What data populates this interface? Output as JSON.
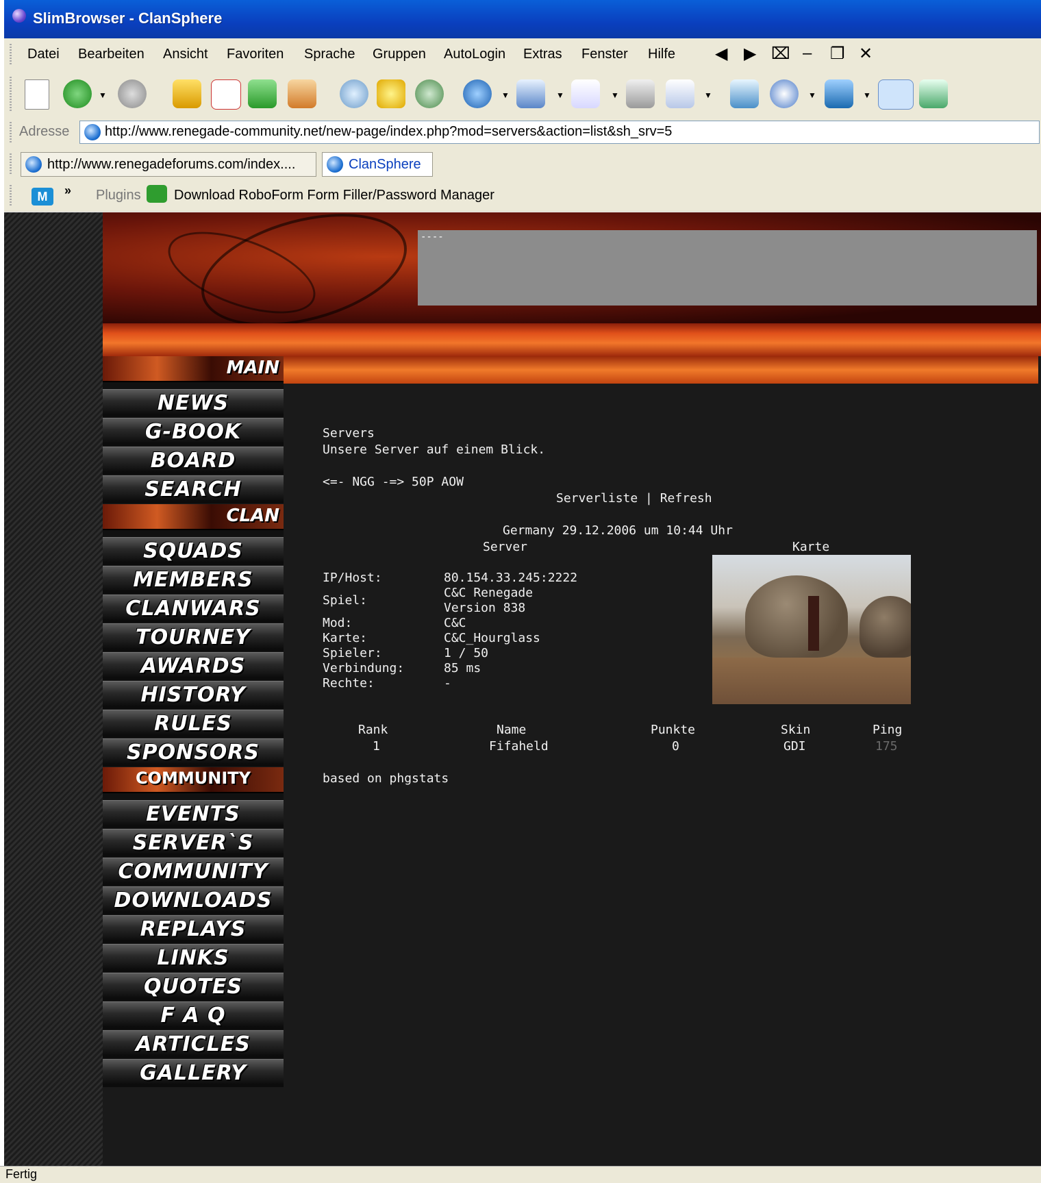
{
  "window": {
    "title": "SlimBrowser - ClanSphere"
  },
  "menu": {
    "items": [
      "Datei",
      "Bearbeiten",
      "Ansicht",
      "Favoriten",
      "Sprache",
      "Gruppen",
      "AutoLogin",
      "Extras",
      "Fenster",
      "Hilfe"
    ]
  },
  "toolbar": {
    "icons": [
      "new-page-icon",
      "back-icon",
      "forward-icon",
      "up-folder-icon",
      "stop-icon",
      "refresh-icon",
      "home-icon",
      "search-icon",
      "favorites-star-icon",
      "history-icon",
      "globe-icon",
      "edit-icon",
      "mail-icon",
      "print-icon",
      "form-icon",
      "popup-icon",
      "zoom-icon",
      "font-icon",
      "maximize-window-icon",
      "tile-window-icon"
    ]
  },
  "address": {
    "label": "Adresse",
    "url": "http://www.renegade-community.net/new-page/index.php?mod=servers&action=list&sh_srv=5"
  },
  "tabs": [
    {
      "label": "http://www.renegadeforums.com/index...."
    },
    {
      "label": "ClanSphere"
    }
  ],
  "linkbar": {
    "chevron": "»",
    "plugins_label": "Plugins",
    "roboform_label": "Download RoboForm Form Filler/Password Manager"
  },
  "banner": {
    "text": "----"
  },
  "nav": {
    "main_label": "MAIN",
    "main_items": [
      "NEWS",
      "G-BOOK",
      "BOARD",
      "SEARCH"
    ],
    "clan_label": "CLAN",
    "clan_items": [
      "SQUADS",
      "MEMBERS",
      "CLANWARS",
      "TOURNEY",
      "AWARDS",
      "HISTORY",
      "RULES",
      "SPONSORS"
    ],
    "community_label": "COMMUNITY",
    "community_items": [
      "EVENTS",
      "SERVER`S",
      "COMMUNITY",
      "DOWNLOADS",
      "REPLAYS",
      "LINKS",
      "QUOTES",
      "F A Q",
      "ARTICLES",
      "GALLERY"
    ]
  },
  "content": {
    "heading": "Servers",
    "subheading": "Unsere Server auf einem Blick.",
    "server_name": "<=- NGG -=> 50P AOW",
    "links": "Serverliste | Refresh",
    "timestamp": "Germany 29.12.2006 um 10:44 Uhr",
    "col_server": "Server",
    "col_map": "Karte",
    "details": [
      {
        "label": "IP/Host:",
        "value": "80.154.33.245:2222"
      },
      {
        "label": "Spiel:",
        "value": "C&C Renegade",
        "value2": "Version 838"
      },
      {
        "label": "Mod:",
        "value": "C&C"
      },
      {
        "label": "Karte:",
        "value": "C&C_Hourglass"
      },
      {
        "label": "Spieler:",
        "value": "1 / 50"
      },
      {
        "label": "Verbindung:",
        "value": "85 ms"
      },
      {
        "label": "Rechte:",
        "value": "-"
      }
    ],
    "players_headers": [
      "Rank",
      "Name",
      "Punkte",
      "Skin",
      "Ping"
    ],
    "players": [
      {
        "rank": "1",
        "name": "Fifaheld",
        "points": "0",
        "skin": "GDI",
        "ping": "175"
      }
    ],
    "footer": "based on phgstats"
  },
  "status": {
    "text": "Fertig"
  }
}
